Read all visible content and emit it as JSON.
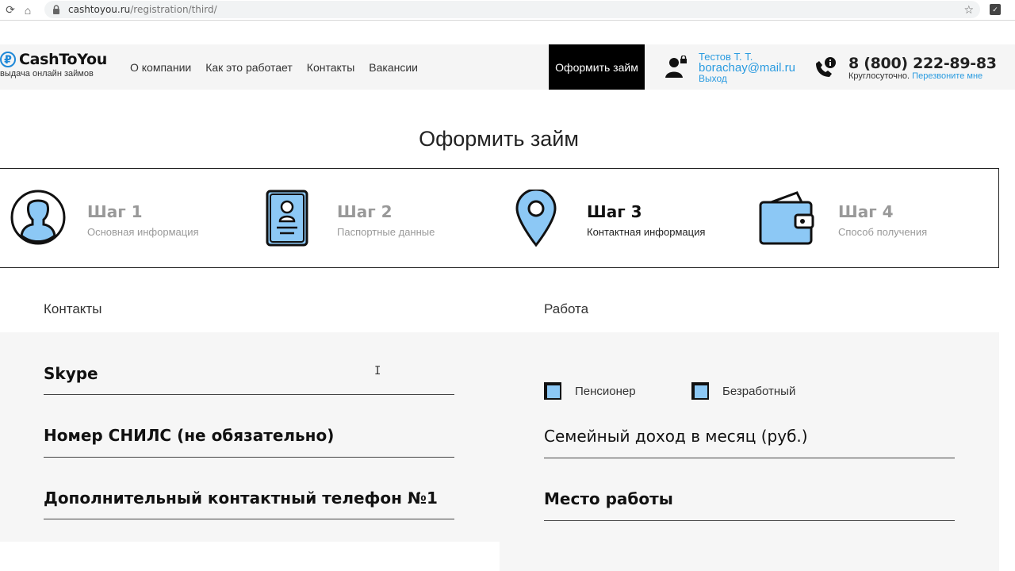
{
  "browser": {
    "url_host": "cashtoyou.ru",
    "url_path": "/registration/third/"
  },
  "header": {
    "logo_name": "CashToYou",
    "logo_symbol": "₽",
    "tagline": "выдача онлайн займов",
    "nav": [
      "О компании",
      "Как это работает",
      "Контакты",
      "Вакансии"
    ],
    "cta": "Оформить займ",
    "user_name": "Тестов Т. Т.",
    "user_email": "borachay@mail.ru",
    "logout": "Выход",
    "phone": "8 (800) 222-89-83",
    "hours": "Круглосуточно.",
    "callback": "Перезвоните мне"
  },
  "page_title": "Оформить займ",
  "steps": [
    {
      "title": "Шаг 1",
      "subtitle": "Основная информация",
      "icon": "user-avatar-icon"
    },
    {
      "title": "Шаг 2",
      "subtitle": "Паспортные данные",
      "icon": "passport-icon"
    },
    {
      "title": "Шаг 3",
      "subtitle": "Контактная информация",
      "icon": "map-pin-icon"
    },
    {
      "title": "Шаг 4",
      "subtitle": "Способ получения",
      "icon": "wallet-icon"
    }
  ],
  "active_step": 3,
  "contacts": {
    "label": "Контакты",
    "fields": [
      "Skype",
      "Номер СНИЛС (не обязательно)",
      "Дополнительный контактный телефон №1"
    ]
  },
  "work": {
    "label": "Работа",
    "checkboxes": [
      "Пенсионер",
      "Безработный"
    ],
    "fields": [
      "Семейный доход в месяц (руб.)",
      "Место работы"
    ]
  },
  "colors": {
    "accent": "#2a9be0",
    "icon_fill": "#8cc8f5",
    "cta_bg": "#000000"
  }
}
